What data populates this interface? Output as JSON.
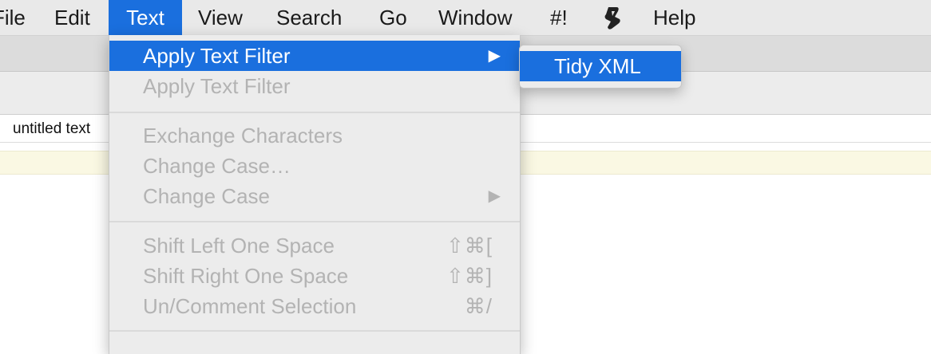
{
  "menubar": {
    "items": [
      {
        "label": "File",
        "active": false
      },
      {
        "label": "Edit",
        "active": false
      },
      {
        "label": "Text",
        "active": true
      },
      {
        "label": "View",
        "active": false
      },
      {
        "label": "Search",
        "active": false
      },
      {
        "label": "Go",
        "active": false
      },
      {
        "label": "Window",
        "active": false
      },
      {
        "label": "#!",
        "active": false
      },
      {
        "label": "Help",
        "active": false
      }
    ],
    "script_icon": "script-scroll-icon"
  },
  "document": {
    "tab_title": "untitled text"
  },
  "text_menu": {
    "items": [
      {
        "label": "Apply Text Filter",
        "submenu": true,
        "highlighted": true,
        "enabled": true
      },
      {
        "label": "Apply Text Filter",
        "enabled": false
      },
      {
        "label": "Exchange Characters",
        "enabled": false
      },
      {
        "label": "Change Case…",
        "enabled": false
      },
      {
        "label": "Change Case",
        "submenu": true,
        "enabled": false
      },
      {
        "label": "Shift Left One Space",
        "shortcut": "⇧⌘[",
        "enabled": false
      },
      {
        "label": "Shift Right One Space",
        "shortcut": "⇧⌘]",
        "enabled": false
      },
      {
        "label": "Un/Comment Selection",
        "shortcut": "⌘/",
        "enabled": false
      }
    ],
    "submenu_arrow": "▶"
  },
  "filter_submenu": {
    "items": [
      {
        "label": "Tidy XML",
        "highlighted": true
      }
    ]
  },
  "colors": {
    "accent": "#1a6fde",
    "menu_bg": "#ececec",
    "disabled_text": "#b3b3b3",
    "line_highlight": "#faf8e3"
  }
}
